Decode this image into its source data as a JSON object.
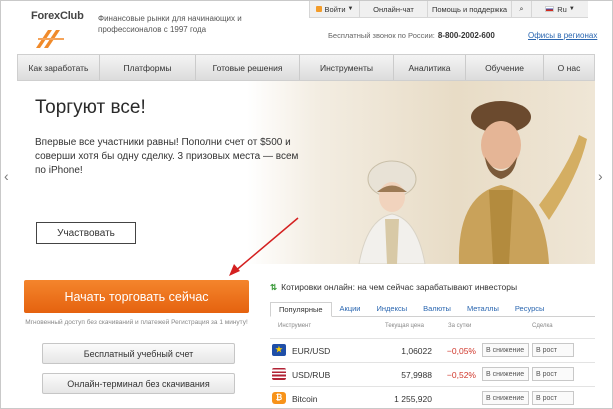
{
  "header": {
    "logo_text": "ForexClub",
    "tagline": "Финансовые рынки для начинающих и профессионалов с 1997 года",
    "topbar": {
      "login": "Войти",
      "chat": "Онлайн-чат",
      "help": "Помощь и поддержка",
      "lang": "Ru"
    },
    "hotline_label": "Бесплатный звонок по России:",
    "hotline_number": "8-800-2002-600",
    "offices_link": "Офисы в регионах"
  },
  "nav": {
    "items": [
      {
        "label": "Как заработать"
      },
      {
        "label": "Платформы"
      },
      {
        "label": "Готовые решения"
      },
      {
        "label": "Инструменты"
      },
      {
        "label": "Аналитика"
      },
      {
        "label": "Обучение"
      },
      {
        "label": "О нас"
      }
    ]
  },
  "hero": {
    "title": "Торгуют все!",
    "text": "Впервые все участники равны! Пополни счет от $500 и соверши хотя бы одну сделку. 3 призовых места — всем по iPhone!",
    "button": "Участвовать",
    "prev_arrow": "‹",
    "next_arrow": "›"
  },
  "cta": {
    "trade_button": "Начать торговать сейчас",
    "trade_note": "Мгновенный доступ без скачиваний и платежей Регистрация за 1 минуту!",
    "demo_button": "Бесплатный учебный счет",
    "web_button": "Онлайн-терминал без скачивания"
  },
  "quotes": {
    "title": "Котировки онлайн: на чем сейчас зарабатывают инвесторы",
    "tabs": [
      {
        "label": "Популярные"
      },
      {
        "label": "Акции"
      },
      {
        "label": "Индексы"
      },
      {
        "label": "Валюты"
      },
      {
        "label": "Металлы"
      },
      {
        "label": "Ресурсы"
      }
    ],
    "headers": {
      "instrument": "Инструмент",
      "price": "Текущая цена",
      "change": "За сутки",
      "deal": "Сделка"
    },
    "rows": [
      {
        "name": "EUR/USD",
        "price": "1,06022",
        "change": "−0,05%",
        "sell": "В снижение",
        "buy": "В рост"
      },
      {
        "name": "USD/RUB",
        "price": "57,9988",
        "change": "−0,52%",
        "sell": "В снижение",
        "buy": "В рост"
      },
      {
        "name": "Bitcoin",
        "price": "1 255,920",
        "change": "",
        "sell": "В снижение",
        "buy": "В рост"
      }
    ]
  },
  "colors": {
    "brand_orange": "#f08a2a",
    "link_blue": "#2a66b0",
    "negative_red": "#d0372b"
  }
}
